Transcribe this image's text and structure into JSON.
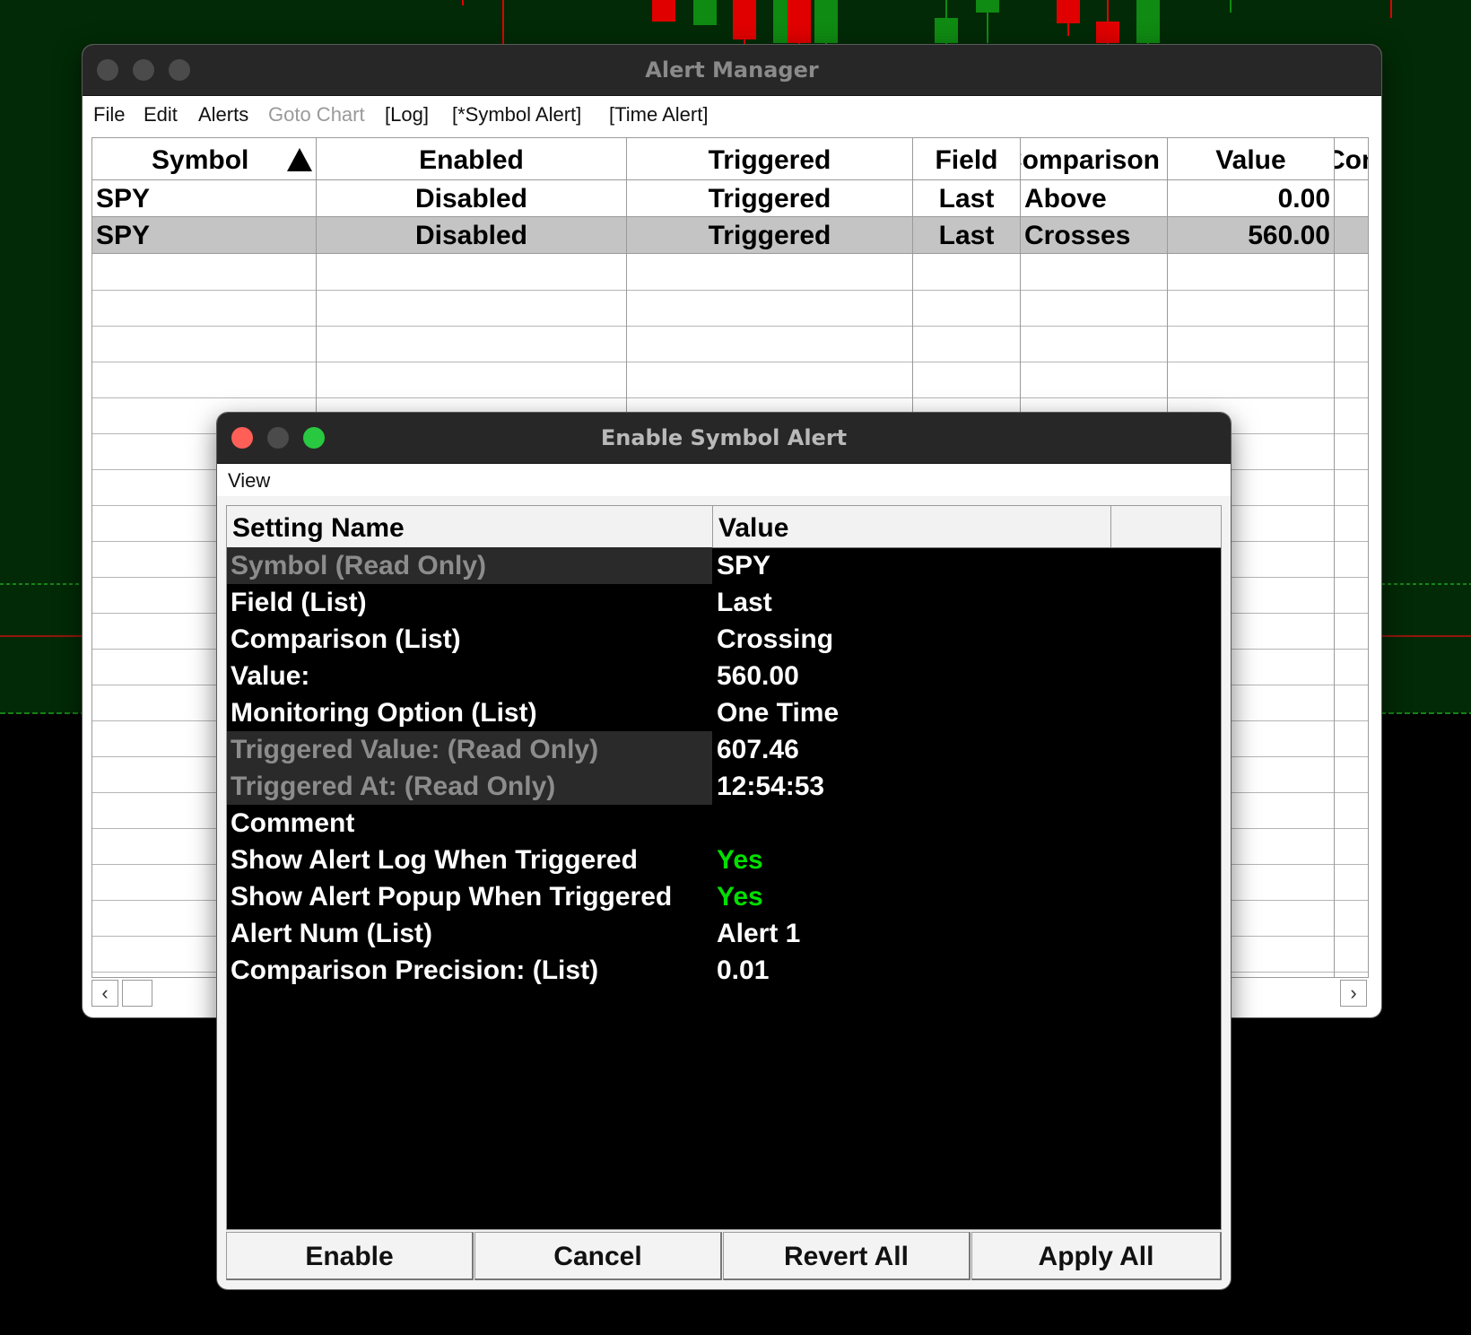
{
  "colors": {
    "chart_bg": "#022a06",
    "candle_up": "#0f8a12",
    "candle_down": "#e00000",
    "yes_green": "#00e000",
    "close_red": "#ff5f57",
    "zoom_green": "#28c840"
  },
  "alert_manager": {
    "title": "Alert Manager",
    "menu": {
      "file": "File",
      "edit": "Edit",
      "alerts": "Alerts",
      "goto_chart": "Goto Chart",
      "log": "[Log]",
      "symbol_alert": "[*Symbol Alert]",
      "time_alert": "[Time Alert]"
    },
    "columns": [
      "Symbol",
      "Enabled",
      "Triggered",
      "Field",
      "Comparison",
      "Value",
      "Com"
    ],
    "sort_icon": "sort-ascending-icon",
    "rows": [
      {
        "symbol": "SPY",
        "enabled": "Disabled",
        "triggered": "Triggered",
        "field": "Last",
        "comparison": "Above",
        "value": "0.00"
      },
      {
        "symbol": "SPY",
        "enabled": "Disabled",
        "triggered": "Triggered",
        "field": "Last",
        "comparison": "Crosses",
        "value": "560.00"
      }
    ],
    "scroll_left": "‹",
    "scroll_right": "›"
  },
  "dialog": {
    "title": "Enable Symbol Alert",
    "menu_view": "View",
    "headers": {
      "name": "Setting Name",
      "value": "Value"
    },
    "settings": [
      {
        "name": "Symbol (Read Only)",
        "value": "SPY",
        "readonly": true
      },
      {
        "name": "Field (List)",
        "value": "Last"
      },
      {
        "name": "Comparison (List)",
        "value": "Crossing"
      },
      {
        "name": "Value:",
        "value": "560.00"
      },
      {
        "name": "Monitoring Option (List)",
        "value": "One Time"
      },
      {
        "name": "Triggered Value: (Read Only)",
        "value": "607.46",
        "readonly": true
      },
      {
        "name": "Triggered At: (Read Only)",
        "value": "12:54:53",
        "readonly": true
      },
      {
        "name": "Comment",
        "value": ""
      },
      {
        "name": "Show Alert Log When Triggered",
        "value": "Yes",
        "green": true
      },
      {
        "name": "Show Alert Popup When Triggered",
        "value": "Yes",
        "green": true
      },
      {
        "name": "Alert Num (List)",
        "value": "Alert 1"
      },
      {
        "name": "Comparison Precision: (List)",
        "value": "0.01"
      }
    ],
    "buttons": {
      "enable": "Enable",
      "cancel": "Cancel",
      "revert_all": "Revert All",
      "apply_all": "Apply All"
    }
  }
}
